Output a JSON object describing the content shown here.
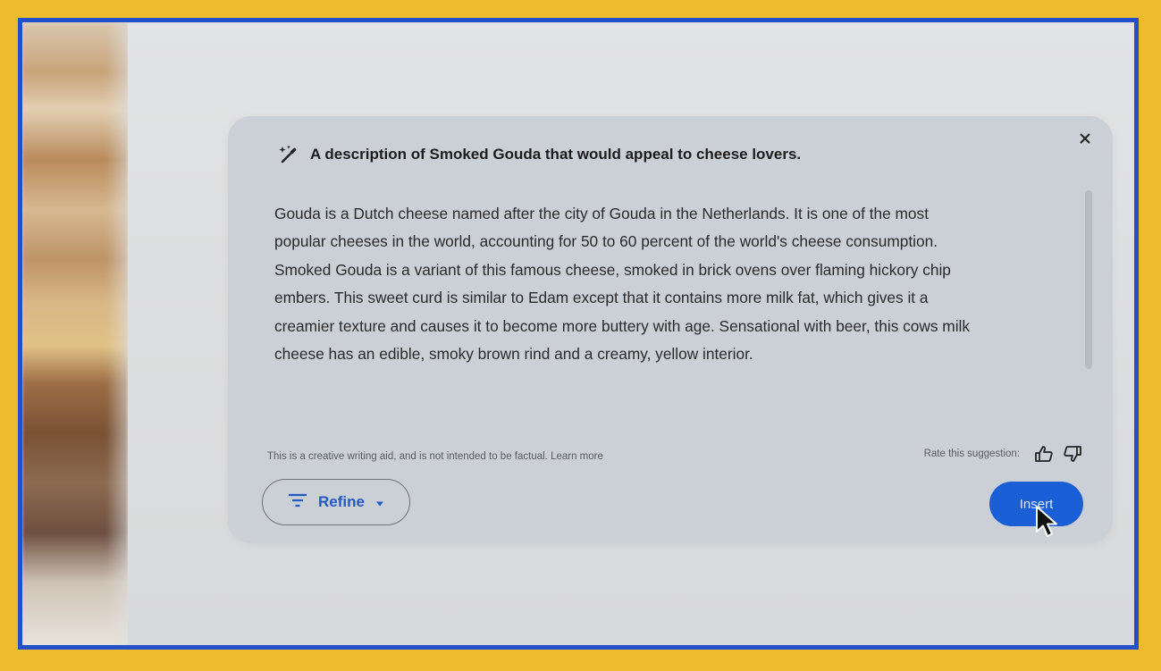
{
  "dialog": {
    "prompt": "A description of Smoked Gouda that would appeal to cheese lovers.",
    "body_lines": [
      "Gouda is a Dutch cheese named after the city of Gouda in the Netherlands. It is one of the most",
      "popular cheeses in the world, accounting for 50 to 60 percent of the world's cheese consumption.",
      "Smoked Gouda is a variant of this famous cheese, smoked in brick ovens over flaming hickory chip",
      "embers. This sweet curd is similar to Edam except that it contains more milk fat, which gives it a",
      "creamier texture and causes it to become more buttery with age. Sensational with beer, this cows milk",
      "cheese has an edible, smoky brown rind and a creamy, yellow interior."
    ],
    "disclaimer": "This is a creative writing aid, and is not intended to be factual. Learn more",
    "rate_label": "Rate this suggestion:",
    "refine_label": "Refine",
    "insert_label": "Insert"
  },
  "icons": {
    "prompt": "magic-wand-icon",
    "close": "close-icon",
    "refine": "filter-icon",
    "dropdown": "caret-down-icon",
    "like": "thumbs-up-icon",
    "dislike": "thumbs-down-icon",
    "pointer": "mouse-cursor-icon"
  },
  "colors": {
    "frame_border": "#2350C9",
    "background_outer": "#ECBB2E",
    "card": "#CBCFD6",
    "accent": "#1A5FD6",
    "refine_text": "#2459C8"
  }
}
